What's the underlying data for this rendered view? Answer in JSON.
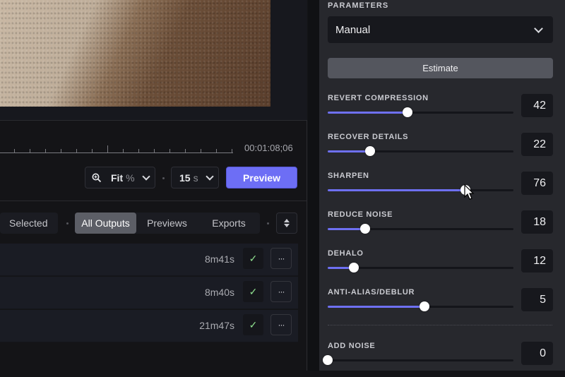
{
  "timeline": {
    "timecode": "00:01:08;06"
  },
  "toolbar": {
    "zoom": {
      "icon": "zoom-in-icon",
      "value": "Fit",
      "unit": "%"
    },
    "duration": {
      "value": "15",
      "unit": "s"
    },
    "preview_label": "Preview"
  },
  "filters": {
    "tabs_left": [
      {
        "label": "Selected",
        "active": false
      }
    ],
    "tabs": [
      {
        "label": "All Outputs",
        "active": true
      },
      {
        "label": "Previews",
        "active": false
      },
      {
        "label": "Exports",
        "active": false
      }
    ],
    "sort_icon": "sort-icon"
  },
  "outputs": [
    {
      "duration": "8m41s",
      "status": "✓",
      "menu": "···"
    },
    {
      "duration": "8m40s",
      "status": "✓",
      "menu": "···"
    },
    {
      "duration": "21m47s",
      "status": "✓",
      "menu": "···"
    }
  ],
  "panel": {
    "section_label": "PARAMETERS",
    "mode": "Manual",
    "estimate_label": "Estimate",
    "params": [
      {
        "label": "REVERT COMPRESSION",
        "value": "42",
        "position": 0.43
      },
      {
        "label": "RECOVER DETAILS",
        "value": "22",
        "position": 0.23
      },
      {
        "label": "SHARPEN",
        "value": "76",
        "position": 0.74
      },
      {
        "label": "REDUCE NOISE",
        "value": "18",
        "position": 0.2
      },
      {
        "label": "DEHALO",
        "value": "12",
        "position": 0.14
      },
      {
        "label": "ANTI-ALIAS/DEBLUR",
        "value": "5",
        "position": 0.52
      }
    ],
    "extra_params": [
      {
        "label": "ADD NOISE",
        "value": "0",
        "position": 0.0
      }
    ]
  },
  "colors": {
    "accent": "#6d6ef5",
    "check": "#8fe08f"
  }
}
